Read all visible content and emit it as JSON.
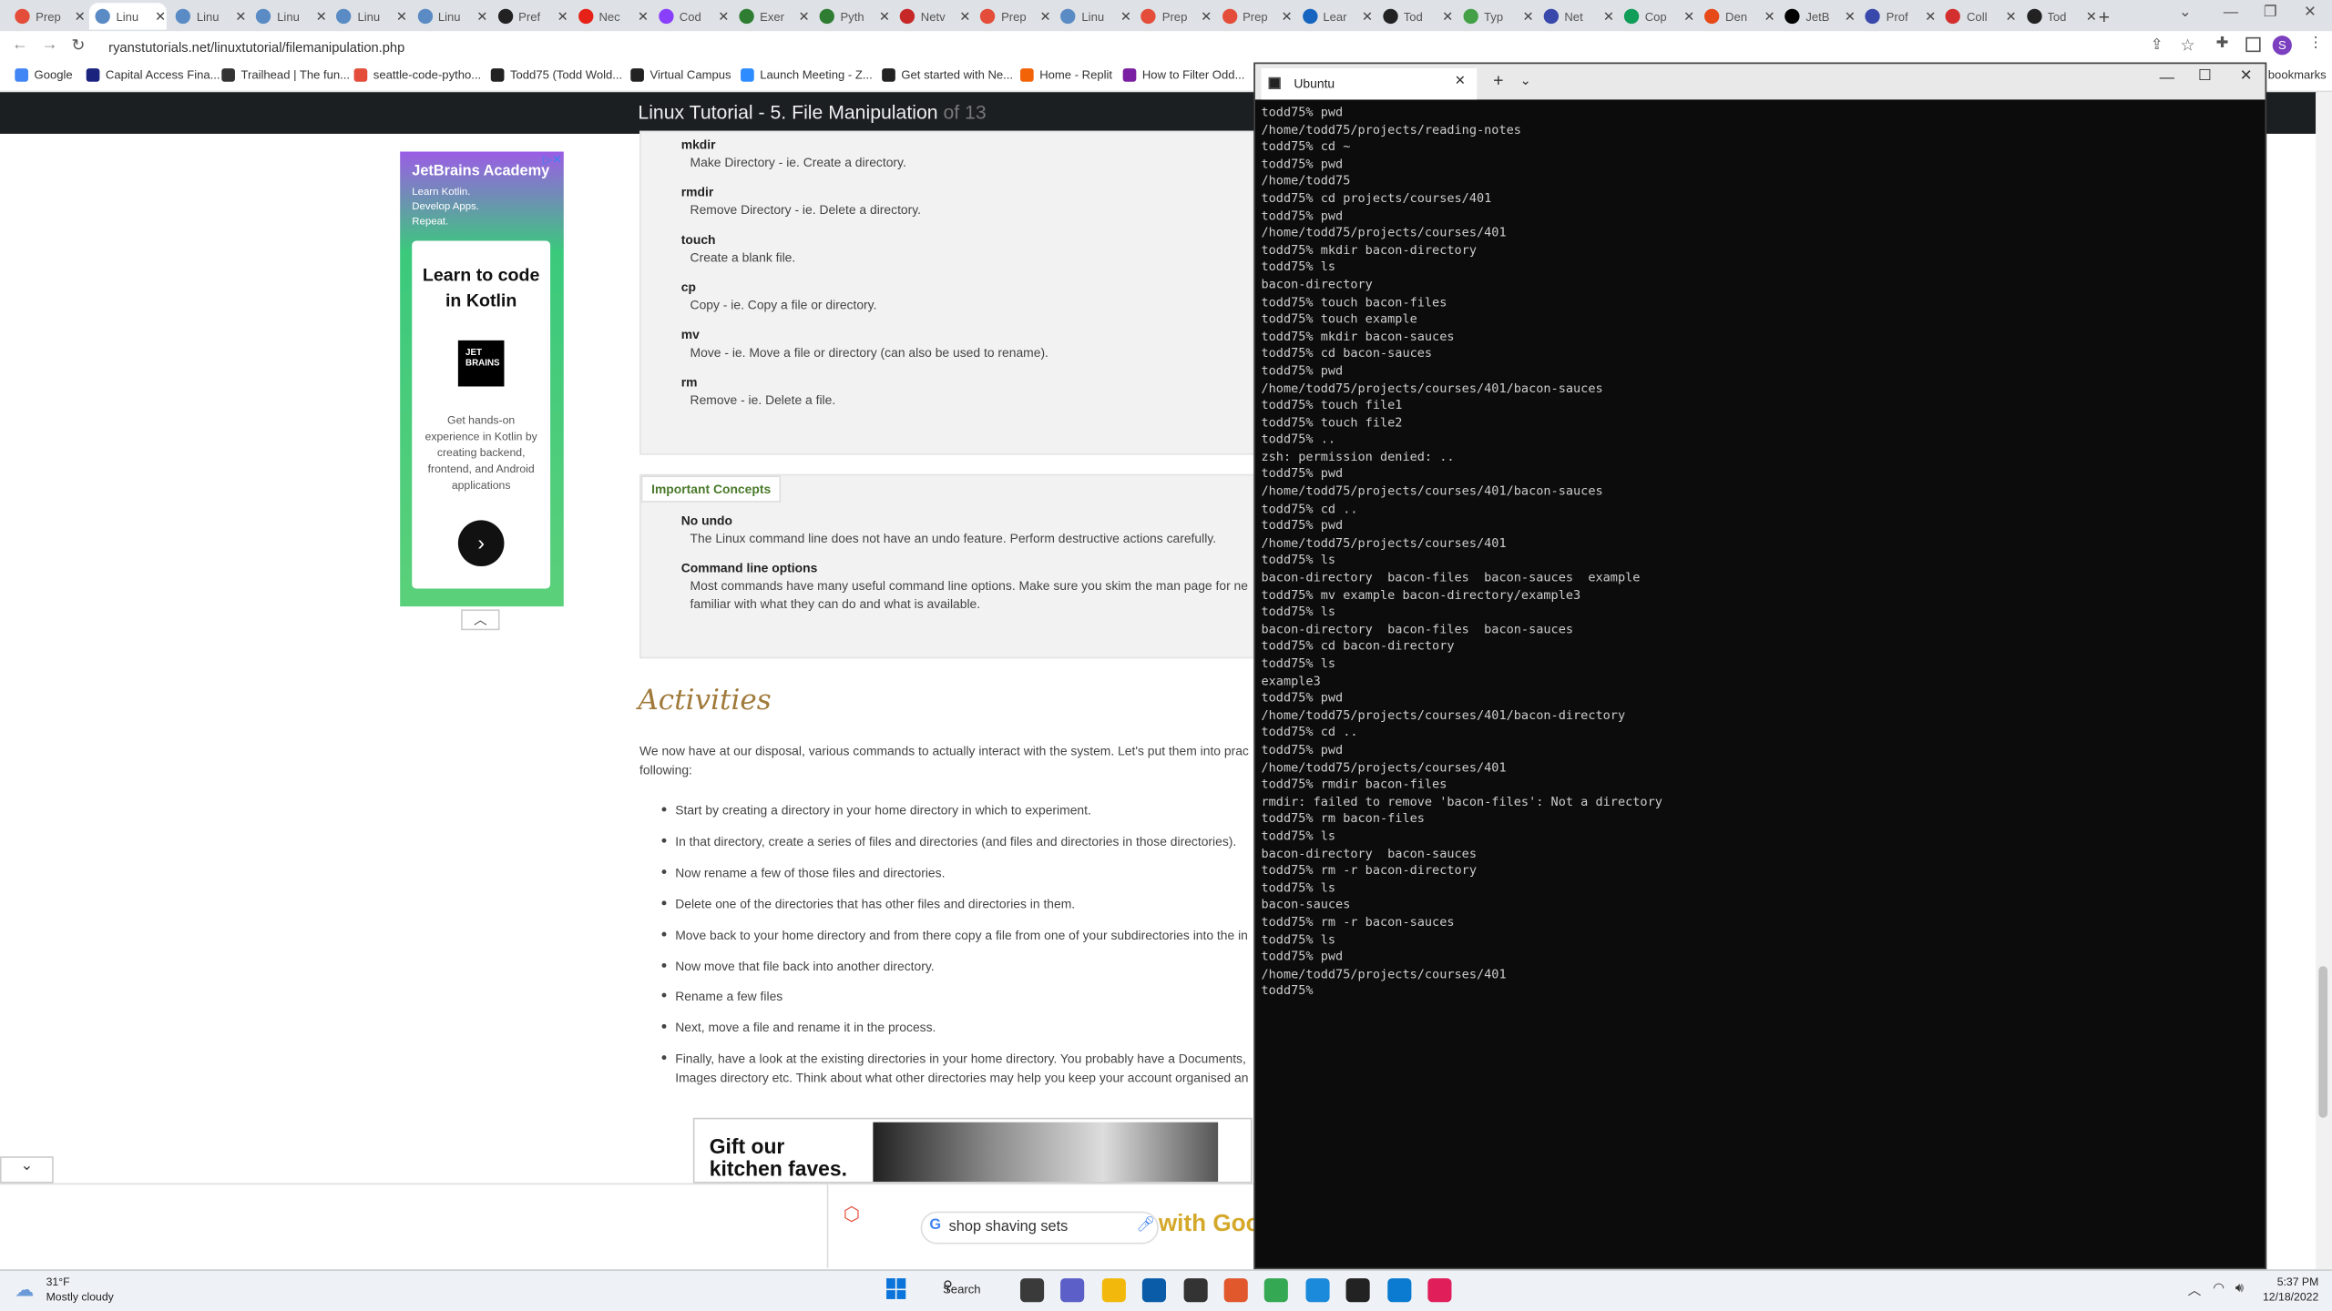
{
  "browser": {
    "tabs": [
      {
        "label": "Prep",
        "color": "#e44d3a"
      },
      {
        "label": "Linu",
        "color": "#5a8bc4",
        "active": true
      },
      {
        "label": "Linu",
        "color": "#5a8bc4"
      },
      {
        "label": "Linu",
        "color": "#5a8bc4"
      },
      {
        "label": "Linu",
        "color": "#5a8bc4"
      },
      {
        "label": "Linu",
        "color": "#5a8bc4"
      },
      {
        "label": "Pref",
        "color": "#222"
      },
      {
        "label": "Nec",
        "color": "#e62117"
      },
      {
        "label": "Cod",
        "color": "#8a3ffc"
      },
      {
        "label": "Exer",
        "color": "#2e7d32"
      },
      {
        "label": "Pyth",
        "color": "#2e7d32"
      },
      {
        "label": "Netv",
        "color": "#c62828"
      },
      {
        "label": "Prep",
        "color": "#e44d3a"
      },
      {
        "label": "Linu",
        "color": "#5a8bc4"
      },
      {
        "label": "Prep",
        "color": "#e44d3a"
      },
      {
        "label": "Prep",
        "color": "#e44d3a"
      },
      {
        "label": "Lear",
        "color": "#1565c0"
      },
      {
        "label": "Tod",
        "color": "#222"
      },
      {
        "label": "Typ",
        "color": "#43a047"
      },
      {
        "label": "Net",
        "color": "#3949ab"
      },
      {
        "label": "Cop",
        "color": "#0f9d58"
      },
      {
        "label": "Den",
        "color": "#e64a19"
      },
      {
        "label": "JetB",
        "color": "#000"
      },
      {
        "label": "Prof",
        "color": "#3949ab"
      },
      {
        "label": "Coll",
        "color": "#d32f2f"
      },
      {
        "label": "Tod",
        "color": "#222"
      }
    ],
    "url": "ryanstutorials.net/linuxtutorial/filemanipulation.php",
    "bookmarks": [
      {
        "label": "Google",
        "color": "#4285f4"
      },
      {
        "label": "Capital Access Fina...",
        "color": "#1a237e"
      },
      {
        "label": "Trailhead | The fun...",
        "color": "#333"
      },
      {
        "label": "seattle-code-pytho...",
        "color": "#e44d3a"
      },
      {
        "label": "Todd75 (Todd Wold...",
        "color": "#222"
      },
      {
        "label": "Virtual Campus",
        "color": "#222"
      },
      {
        "label": "Launch Meeting - Z...",
        "color": "#2d8cff"
      },
      {
        "label": "Get started with Ne...",
        "color": "#222"
      },
      {
        "label": "Home - Replit",
        "color": "#f26207"
      },
      {
        "label": "How to Filter Odd...",
        "color": "#7b1fa2"
      }
    ],
    "bookmarks_right": "bookmarks",
    "profile_initial": "S"
  },
  "site": {
    "title": "Linux Tutorial - 5. File Manipulation",
    "title_suffix": " of 13",
    "commands": [
      {
        "name": "mkdir",
        "desc": "Make Directory - ie. Create a directory."
      },
      {
        "name": "rmdir",
        "desc": "Remove Directory - ie. Delete a directory."
      },
      {
        "name": "touch",
        "desc": "Create a blank file."
      },
      {
        "name": "cp",
        "desc": "Copy - ie. Copy a file or directory."
      },
      {
        "name": "mv",
        "desc": "Move - ie. Move a file or directory (can also be used to rename)."
      },
      {
        "name": "rm",
        "desc": "Remove - ie. Delete a file."
      }
    ],
    "concepts_tab": "Important Concepts",
    "concepts": [
      {
        "name": "No undo",
        "desc": "The Linux command line does not have an undo feature. Perform destructive actions carefully."
      },
      {
        "name": "Command line options",
        "desc": "Most commands have many useful command line options. Make sure you skim the man page for ne",
        "desc2": "familiar with what they can do and what is available."
      }
    ],
    "activities_heading": "Activities",
    "activities_intro": "We now have at our disposal, various commands to actually interact with the system. Let's put them into prac",
    "activities_intro2": "following:",
    "activities": [
      "Start by creating a directory in your home directory in which to experiment.",
      "In that directory, create a series of files and directories (and files and directories in those directories).",
      "Now rename a few of those files and directories.",
      "Delete one of the directories that has other files and directories in them.",
      "Move back to your home directory and from there copy a file from one of your subdirectories into the in",
      "Now move that file back into another directory.",
      "Rename a few files",
      "Next, move a file and rename it in the process.",
      "Finally, have a look at the existing directories in your home directory. You probably have a Documents,"
    ],
    "activities_last2": "Images directory etc. Think about what other directories may help you keep your account organised an",
    "ad": {
      "brand": "JetBrains Academy",
      "tagline1": "Learn Kotlin.",
      "tagline2": "Develop Apps.",
      "tagline3": "Repeat.",
      "headline1": "Learn to code",
      "headline2": "in Kotlin",
      "logo1": "JET",
      "logo2": "BRAINS",
      "body1": "Get hands-on",
      "body2": "experience in Kotlin by",
      "body3": "creating backend,",
      "body4": "frontend, and Android",
      "body5": "applications"
    },
    "banner_ad": {
      "line1": "Gift our",
      "line2": "kitchen faves."
    }
  },
  "shopbar": {
    "query": "shop shaving sets",
    "suffix": "with Goo"
  },
  "terminal": {
    "title": "Ubuntu",
    "lines": [
      "todd75% pwd",
      "/home/todd75/projects/reading-notes",
      "todd75% cd ~",
      "todd75% pwd",
      "/home/todd75",
      "todd75% cd projects/courses/401",
      "todd75% pwd",
      "/home/todd75/projects/courses/401",
      "todd75% mkdir bacon-directory",
      "todd75% ls",
      "bacon-directory",
      "todd75% touch bacon-files",
      "todd75% touch example",
      "todd75% mkdir bacon-sauces",
      "todd75% cd bacon-sauces",
      "todd75% pwd",
      "/home/todd75/projects/courses/401/bacon-sauces",
      "todd75% touch file1",
      "todd75% touch file2",
      "todd75% ..",
      "zsh: permission denied: ..",
      "todd75% pwd",
      "/home/todd75/projects/courses/401/bacon-sauces",
      "todd75% cd ..",
      "todd75% pwd",
      "/home/todd75/projects/courses/401",
      "todd75% ls",
      "bacon-directory  bacon-files  bacon-sauces  example",
      "todd75% mv example bacon-directory/example3",
      "todd75% ls",
      "bacon-directory  bacon-files  bacon-sauces",
      "todd75% cd bacon-directory",
      "todd75% ls",
      "example3",
      "todd75% pwd",
      "/home/todd75/projects/courses/401/bacon-directory",
      "todd75% cd ..",
      "todd75% pwd",
      "/home/todd75/projects/courses/401",
      "todd75% rmdir bacon-files",
      "rmdir: failed to remove 'bacon-files': Not a directory",
      "todd75% rm bacon-files",
      "todd75% ls",
      "bacon-directory  bacon-sauces",
      "todd75% rm -r bacon-directory",
      "todd75% ls",
      "bacon-sauces",
      "todd75% rm -r bacon-sauces",
      "todd75% ls",
      "todd75% pwd",
      "/home/todd75/projects/courses/401",
      "todd75% "
    ]
  },
  "taskbar": {
    "weather_temp": "31°F",
    "weather_desc": "Mostly cloudy",
    "search_label": "Search",
    "time": "5:37 PM",
    "date": "12/18/2022"
  }
}
